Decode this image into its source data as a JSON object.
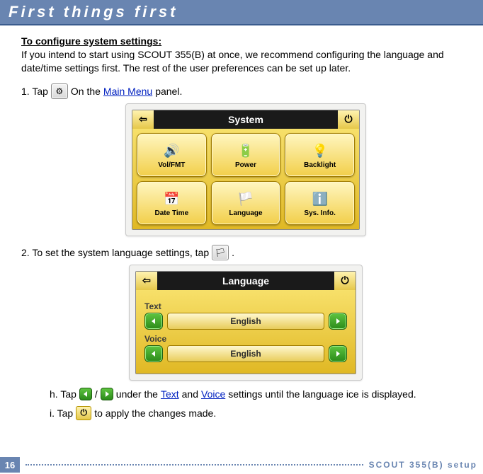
{
  "header": {
    "title": "First things first"
  },
  "intro": {
    "config_title": "To configure system settings:",
    "text": "If you intend to start using SCOUT 355(B) at once, we recommend configuring the language and date/time settings first. The rest of the user preferences can be set up later."
  },
  "step1": {
    "prefix": "1. Tap",
    "suffix_before_link": " On the ",
    "link": "Main Menu",
    "suffix_after_link": " panel."
  },
  "system_screen": {
    "title": "System",
    "tiles": [
      {
        "icon": "volume-icon",
        "glyph": "🔊",
        "label": "Vol/FMT"
      },
      {
        "icon": "power-icon",
        "glyph": "🔋",
        "label": "Power"
      },
      {
        "icon": "backlight-icon",
        "glyph": "💡",
        "label": "Backlight"
      },
      {
        "icon": "datetime-icon",
        "glyph": "📅",
        "label": "Date Time"
      },
      {
        "icon": "language-icon",
        "glyph": "🏳️",
        "label": "Language"
      },
      {
        "icon": "sysinfo-icon",
        "glyph": "ℹ️",
        "label": "Sys. Info."
      }
    ]
  },
  "step2": {
    "text_before": "2. To set the system language settings, tap",
    "text_after": "."
  },
  "language_screen": {
    "title": "Language",
    "sections": [
      {
        "label": "Text",
        "value": "English"
      },
      {
        "label": "Voice",
        "value": "English"
      }
    ]
  },
  "sub_h": {
    "prefix": "h. Tap",
    "mid": "/",
    "after": "under the ",
    "link1": "Text",
    "and": " and ",
    "link2": "Voice",
    "rest": " settings until the language ice is displayed."
  },
  "sub_i": {
    "prefix": "i. Tap",
    "rest": " to apply the changes made."
  },
  "footer": {
    "page": "16",
    "label": "SCOUT 355(B) setup"
  }
}
